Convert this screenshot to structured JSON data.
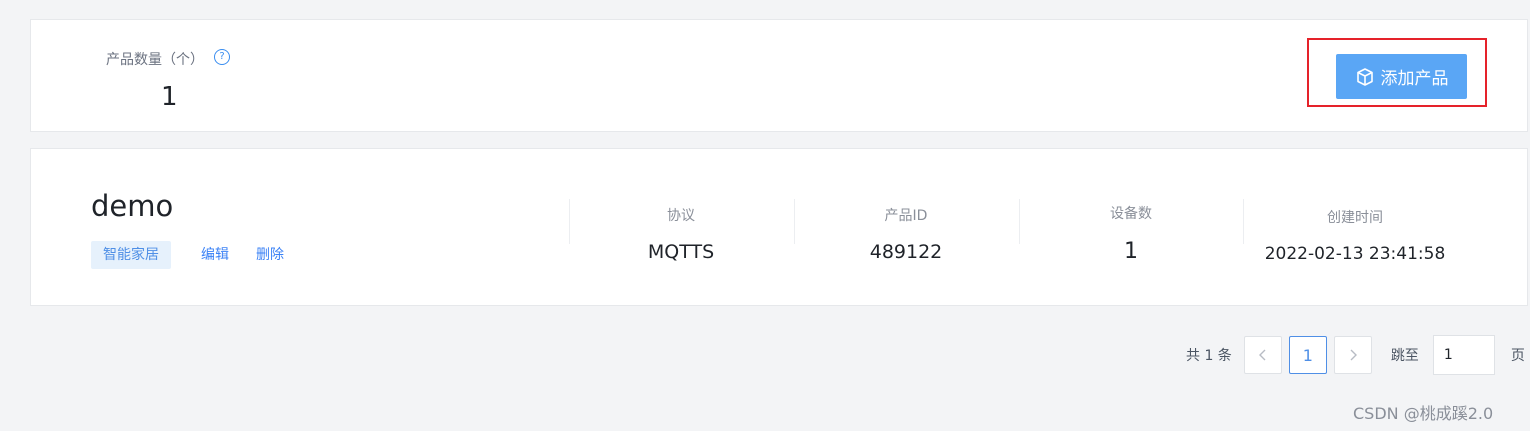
{
  "summary": {
    "count_label": "产品数量（个）",
    "help_icon": "question-circle-icon",
    "count_value": "1",
    "add_button_label": "添加产品",
    "add_button_icon": "cube-icon",
    "add_button_color": "#5aa6f5",
    "highlight_color": "#e5222a"
  },
  "product": {
    "name": "demo",
    "category": "智能家居",
    "edit_label": "编辑",
    "delete_label": "删除",
    "stats": [
      {
        "label": "协议",
        "value": "MQTTS"
      },
      {
        "label": "产品ID",
        "value": "489122"
      },
      {
        "label": "设备数",
        "value": "1"
      },
      {
        "label": "创建时间",
        "value": "2022-02-13 23:41:58"
      }
    ]
  },
  "pagination": {
    "total_text": "共 1 条",
    "prev_icon": "chevron-left-icon",
    "current_page": "1",
    "next_icon": "chevron-right-icon",
    "jump_label": "跳至",
    "jump_value": "1",
    "page_suffix": "页"
  },
  "watermark": "CSDN @桃成蹊2.0"
}
